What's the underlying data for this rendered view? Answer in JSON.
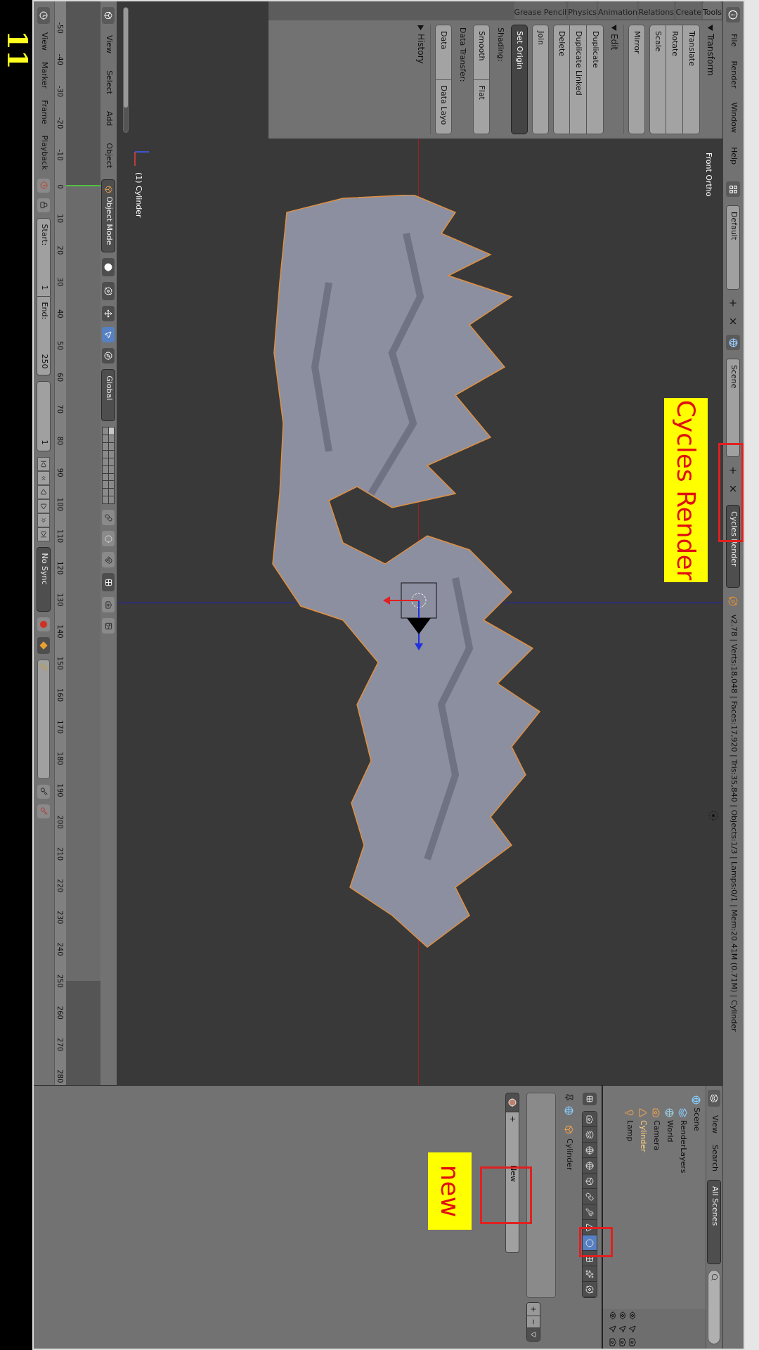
{
  "info_bar": {
    "menus": [
      "File",
      "Render",
      "Window",
      "Help"
    ],
    "layout": "Default",
    "scene": "Scene",
    "engine": "Cycles Render",
    "stats": "v2.78 | Verts:18,048 | Faces:17,920 | Tris:35,840 | Objects:1/3 | Lamps:0/1 | Mem:20.41M (0.71M) | Cylinder"
  },
  "tool_shelf": {
    "tabs": [
      {
        "label": "Grease Pencil",
        "selected": false
      },
      {
        "label": "Physics",
        "selected": false
      },
      {
        "label": "Animation",
        "selected": false
      },
      {
        "label": "Relations",
        "selected": false
      },
      {
        "label": "Create",
        "selected": false
      },
      {
        "label": "Tools",
        "selected": true
      }
    ],
    "panels": [
      {
        "title": "Transform",
        "expanded": true,
        "groups": [
          {
            "kind": "stack",
            "items": [
              "Translate",
              "Rotate",
              "Scale"
            ]
          },
          {
            "kind": "stack",
            "items": [
              "Mirror"
            ]
          }
        ]
      },
      {
        "title": "Edit",
        "expanded": true,
        "groups": [
          {
            "kind": "stack",
            "items": [
              "Duplicate",
              "Duplicate Linked",
              "Delete"
            ]
          },
          {
            "kind": "stack",
            "items": [
              "Join"
            ]
          },
          {
            "kind": "menu",
            "items": [
              "Set Origin"
            ]
          },
          {
            "kind": "label",
            "items": [
              "Shading:"
            ]
          },
          {
            "kind": "row",
            "items": [
              "Smooth",
              "Flat"
            ]
          },
          {
            "kind": "label",
            "items": [
              "Data Transfer:"
            ]
          },
          {
            "kind": "row",
            "items": [
              "Data",
              "Data Layo"
            ]
          }
        ]
      },
      {
        "title": "History",
        "expanded": false
      }
    ]
  },
  "viewport": {
    "view_name": "Front Ortho",
    "object_label": "(1) Cylinder"
  },
  "view3d_header": {
    "menus": [
      "View",
      "Select",
      "Add",
      "Object"
    ],
    "mode": "Object Mode",
    "orientation": "Global"
  },
  "timeline": {
    "ruler": [
      "-50",
      "-40",
      "-30",
      "-20",
      "-10",
      "0",
      "10",
      "20",
      "30",
      "40",
      "50",
      "60",
      "70",
      "80",
      "90",
      "100",
      "110",
      "120",
      "130",
      "140",
      "150",
      "160",
      "170",
      "180",
      "190",
      "200",
      "210",
      "220",
      "230",
      "240",
      "250",
      "260",
      "270",
      "280"
    ],
    "menus": [
      "View",
      "Marker",
      "Frame",
      "Playback"
    ],
    "start_label": "Start:",
    "start": "1",
    "end_label": "End:",
    "end": "250",
    "current": "1",
    "sync": "No Sync"
  },
  "outliner": {
    "menus": [
      "View",
      "Search"
    ],
    "filter": "All Scenes",
    "tree": [
      {
        "name": "Scene",
        "kind": "scene",
        "selected": false,
        "children": [
          {
            "name": "RenderLayers",
            "kind": "renderlayers",
            "selected": false
          },
          {
            "name": "World",
            "kind": "world",
            "selected": false
          },
          {
            "name": "Camera",
            "kind": "camera",
            "selected": false
          },
          {
            "name": "Cylinder",
            "kind": "mesh",
            "selected": true
          },
          {
            "name": "Lamp",
            "kind": "lamp",
            "selected": false
          }
        ]
      }
    ]
  },
  "properties": {
    "tabs": [
      {
        "kind": "render",
        "selected": false
      },
      {
        "kind": "layers",
        "selected": false
      },
      {
        "kind": "scene",
        "selected": false
      },
      {
        "kind": "world",
        "selected": false
      },
      {
        "kind": "object",
        "selected": false
      },
      {
        "kind": "constraints",
        "selected": false
      },
      {
        "kind": "modifiers",
        "selected": false
      },
      {
        "kind": "data",
        "selected": false
      },
      {
        "kind": "material",
        "selected": true
      },
      {
        "kind": "texture",
        "selected": false
      },
      {
        "kind": "particles",
        "selected": false
      },
      {
        "kind": "physics",
        "selected": false
      }
    ],
    "context": "Cylinder",
    "new_button": "New"
  },
  "annotations": [
    {
      "kind": "engine",
      "text": "Cycles Render"
    },
    {
      "kind": "new",
      "text": "new"
    },
    {
      "kind": "step",
      "text": "11"
    }
  ]
}
